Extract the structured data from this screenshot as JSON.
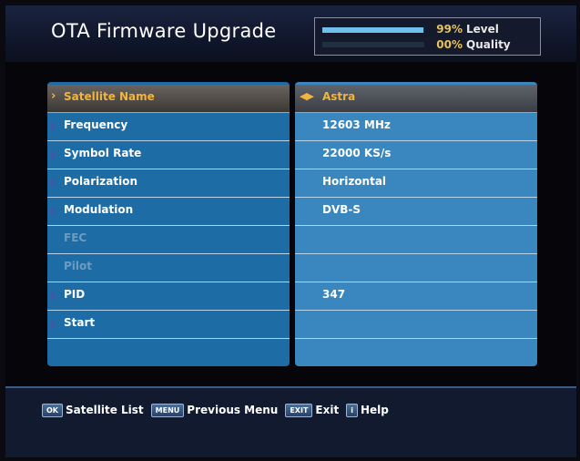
{
  "header": {
    "title": "OTA Firmware Upgrade",
    "signal": {
      "level": {
        "percent_text": "99%",
        "label": "Level",
        "fill": 0.99
      },
      "quality": {
        "percent_text": "00%",
        "label": "Quality",
        "fill": 0.0
      }
    }
  },
  "settings": {
    "rows": [
      {
        "label": "Satellite Name",
        "value": "Astra",
        "selected": true,
        "enabled": true
      },
      {
        "label": "Frequency",
        "value": "12603 MHz",
        "selected": false,
        "enabled": true
      },
      {
        "label": "Symbol Rate",
        "value": "22000 KS/s",
        "selected": false,
        "enabled": true
      },
      {
        "label": "Polarization",
        "value": "Horizontal",
        "selected": false,
        "enabled": true
      },
      {
        "label": "Modulation",
        "value": "DVB-S",
        "selected": false,
        "enabled": true
      },
      {
        "label": "FEC",
        "value": "",
        "selected": false,
        "enabled": false
      },
      {
        "label": "Pilot",
        "value": "",
        "selected": false,
        "enabled": false
      },
      {
        "label": "PID",
        "value": "347",
        "selected": false,
        "enabled": true
      },
      {
        "label": "Start",
        "value": "",
        "selected": false,
        "enabled": true
      },
      {
        "label": "",
        "value": "",
        "selected": false,
        "enabled": true
      }
    ]
  },
  "footer": {
    "ok_key": "OK",
    "ok_label": "Satellite List",
    "menu_key": "MENU",
    "menu_label": "Previous Menu",
    "exit_key": "EXIT",
    "exit_label": "Exit",
    "help_key": "i",
    "help_label": "Help"
  },
  "colors": {
    "highlight": "#f2b43c",
    "panel_left": "#1d6ca6",
    "panel_right": "#3a87bf",
    "signal_bar": "#6fc1ea"
  }
}
